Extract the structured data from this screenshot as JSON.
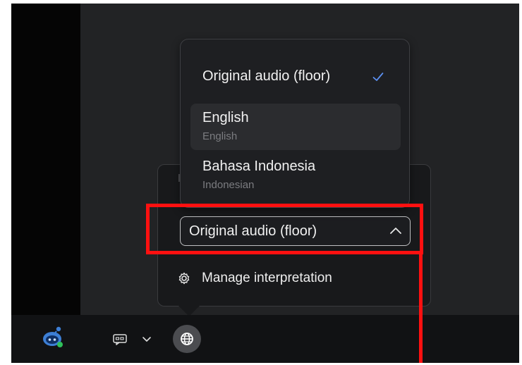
{
  "interpretation": {
    "menu": {
      "items": [
        {
          "label": "Original audio (floor)",
          "sublabel": "",
          "checked": true
        },
        {
          "label": "English",
          "sublabel": "English",
          "checked": false
        },
        {
          "label": "Bahasa Indonesia",
          "sublabel": "Indonesian",
          "checked": false
        }
      ]
    },
    "selector": {
      "value": "Original audio (floor)",
      "chevron": "chevron-up-icon"
    },
    "manage": {
      "label": "Manage interpretation",
      "icon": "gear-icon"
    }
  },
  "taskbar": {
    "icons": [
      "assistant-bot-icon",
      "captions-icon",
      "chevron-down-icon",
      "globe-icon"
    ]
  },
  "colors": {
    "highlight": "#ff1010",
    "panel": "#18191b",
    "menu": "#1e1f22",
    "background": "#222325"
  }
}
